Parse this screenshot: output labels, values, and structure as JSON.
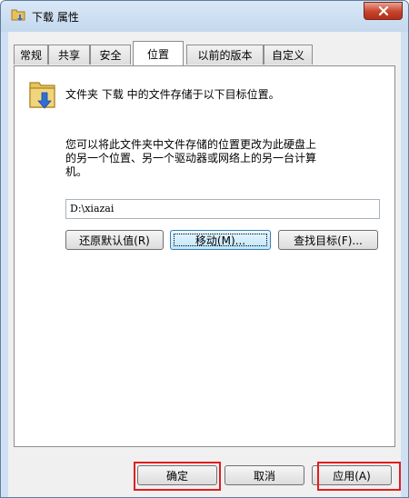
{
  "window": {
    "title": "下载 属性",
    "icons": {
      "title": "folder-icon",
      "close": "close-icon"
    }
  },
  "tabs": [
    "常规",
    "共享",
    "安全",
    "位置",
    "以前的版本",
    "自定义"
  ],
  "active_tab": "位置",
  "location": {
    "heading": "文件夹 下载 中的文件存储于以下目标位置。",
    "description_line1": "您可以将此文件夹中文件存储的位置更改为此硬盘上",
    "description_line2": "的另一个位置、另一个驱动器或网络上的另一台计算",
    "description_line3": "机。",
    "path_value": "D:\\xiazai"
  },
  "buttons": {
    "restore_default": "还原默认值(R)",
    "move": "移动(M)...",
    "find_target": "查找目标(F)...",
    "ok": "确定",
    "cancel": "取消",
    "apply": "应用(A)"
  },
  "colors": {
    "highlight": "#e21e1e",
    "close": "#c6432b"
  }
}
